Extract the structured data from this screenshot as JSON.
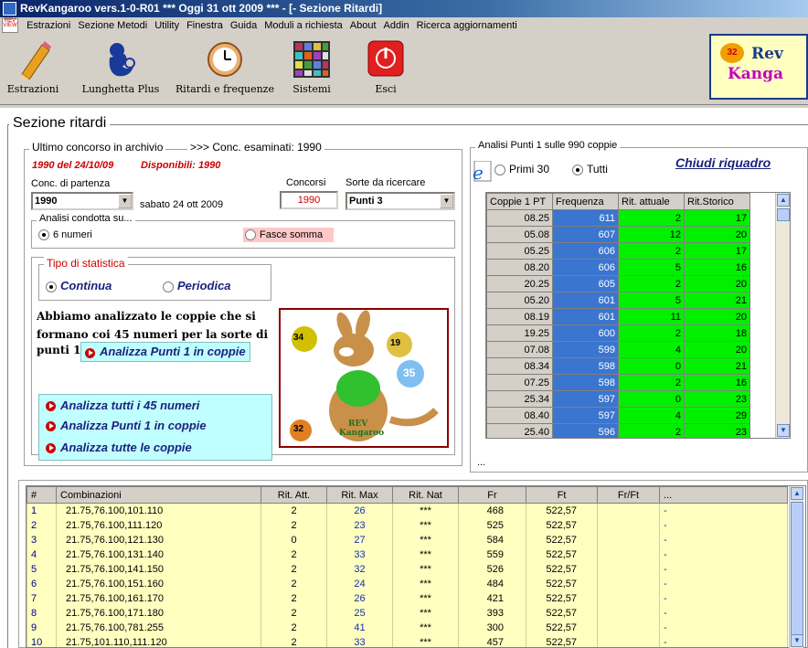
{
  "window": {
    "title": "RevKangaroo vers.1-0-R01   ***   Oggi 31 ott 2009   ***   - [- Sezione Ritardi]"
  },
  "menu": [
    "Estrazioni",
    "Sezione Metodi",
    "Utility",
    "Finestra",
    "Guida",
    "Moduli a richiesta",
    "About",
    "Addin",
    "Ricerca aggiornamenti"
  ],
  "toolbar": {
    "items": [
      {
        "label": "Estrazioni",
        "icon": "pencil-icon"
      },
      {
        "label": "Lunghetta Plus",
        "icon": "lottery-logo-icon"
      },
      {
        "label": "Ritardi e frequenze",
        "icon": "clock-icon"
      },
      {
        "label": "Sistemi",
        "icon": "grid-icon"
      },
      {
        "label": "Esci",
        "icon": "exit-icon"
      }
    ],
    "logo": {
      "line1": "Rev",
      "line2": "Kanga",
      "ball": "32"
    }
  },
  "section": {
    "title": "Sezione ritardi"
  },
  "archive": {
    "group_title": "Ultimo concorso in archivio",
    "examined": ">>> Conc. esaminati: 1990",
    "last": "1990 del 24/10/09",
    "available": "Disponibili: 1990",
    "conc_label": "Conc. di partenza",
    "conc_value": "1990",
    "conc_date": "sabato 24 ott 2009",
    "concorsi_label": "Concorsi",
    "concorsi_value": "1990",
    "sorte_label": "Sorte da ricercare",
    "sorte_value": "Punti 3"
  },
  "analisi": {
    "title": "Analisi condotta su...",
    "opt1": "6 numeri",
    "opt2": "Fasce somma"
  },
  "tipo": {
    "title": "Tipo di statistica",
    "opt1": "Continua",
    "opt2": "Periodica"
  },
  "description": {
    "line1": "Abbiamo analizzato le coppie che si",
    "line2": "formano coi 45 numeri per la sorte di",
    "line3": "punti 1",
    "action": "Analizza Punti 1 in coppie"
  },
  "actions": [
    "Analizza tutti i 45 numeri",
    "Analizza Punti 1 in coppie",
    "Analizza tutte le coppie"
  ],
  "kangaroo": {
    "balls": [
      "34",
      "19",
      "35",
      "32"
    ],
    "text1": "REV",
    "text2": "Kangaroo"
  },
  "right": {
    "group_title": "Analisi Punti 1 sulle 990 coppie",
    "opt1": "Primi 30",
    "opt2": "Tutti",
    "close": "Chiudi riquadro",
    "footer": "...",
    "columns": [
      "Coppie 1 PT",
      "Frequenza",
      "Rit. attuale",
      "Rit.Storico"
    ],
    "rows": [
      [
        "08.25",
        "611",
        "2",
        "17"
      ],
      [
        "05.08",
        "607",
        "12",
        "20"
      ],
      [
        "05.25",
        "606",
        "2",
        "17"
      ],
      [
        "08.20",
        "606",
        "5",
        "16"
      ],
      [
        "20.25",
        "605",
        "2",
        "20"
      ],
      [
        "05.20",
        "601",
        "5",
        "21"
      ],
      [
        "08.19",
        "601",
        "11",
        "20"
      ],
      [
        "19.25",
        "600",
        "2",
        "18"
      ],
      [
        "07.08",
        "599",
        "4",
        "20"
      ],
      [
        "08.34",
        "598",
        "0",
        "21"
      ],
      [
        "07.25",
        "598",
        "2",
        "16"
      ],
      [
        "25.34",
        "597",
        "0",
        "23"
      ],
      [
        "08.40",
        "597",
        "4",
        "29"
      ],
      [
        "25.40",
        "596",
        "2",
        "23"
      ]
    ]
  },
  "bottom": {
    "columns": [
      "#",
      "Combinazioni",
      "Rit. Att.",
      "Rit. Max",
      "Rit. Nat",
      "Fr",
      "Ft",
      "Fr/Ft",
      "..."
    ],
    "rows": [
      [
        "1",
        "21.75,76.100,101.110",
        "2",
        "26",
        "***",
        "468",
        "522,57",
        "",
        "-"
      ],
      [
        "2",
        "21.75,76.100,111.120",
        "2",
        "23",
        "***",
        "525",
        "522,57",
        "",
        "-"
      ],
      [
        "3",
        "21.75,76.100,121.130",
        "0",
        "27",
        "***",
        "584",
        "522,57",
        "",
        "-"
      ],
      [
        "4",
        "21.75,76.100,131.140",
        "2",
        "33",
        "***",
        "559",
        "522,57",
        "",
        "-"
      ],
      [
        "5",
        "21.75,76.100,141.150",
        "2",
        "32",
        "***",
        "526",
        "522,57",
        "",
        "-"
      ],
      [
        "6",
        "21.75,76.100,151.160",
        "2",
        "24",
        "***",
        "484",
        "522,57",
        "",
        "-"
      ],
      [
        "7",
        "21.75,76.100,161.170",
        "2",
        "26",
        "***",
        "421",
        "522,57",
        "",
        "-"
      ],
      [
        "8",
        "21.75,76.100,171.180",
        "2",
        "25",
        "***",
        "393",
        "522,57",
        "",
        "-"
      ],
      [
        "9",
        "21.75,76.100,781.255",
        "2",
        "41",
        "***",
        "300",
        "522,57",
        "",
        "-"
      ],
      [
        "10",
        "21.75,101.110,111.120",
        "2",
        "33",
        "***",
        "457",
        "522,57",
        "",
        "-"
      ]
    ]
  }
}
